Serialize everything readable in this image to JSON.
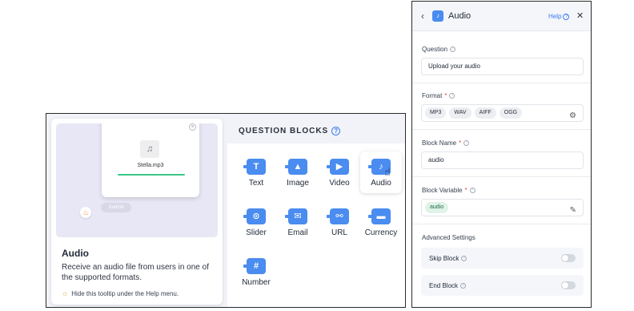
{
  "tooltip": {
    "file_name": "Stella.mp3",
    "submit_label": "Submit",
    "title": "Audio",
    "description": "Receive an audio file from users in one of the supported formats.",
    "hint": "Hide this tooltip under the Help menu."
  },
  "question_blocks": {
    "header": "QUESTION BLOCKS",
    "items": [
      {
        "label": "Text",
        "icon": "text-icon",
        "glyph": "T"
      },
      {
        "label": "Image",
        "icon": "image-icon",
        "glyph": "▲"
      },
      {
        "label": "Video",
        "icon": "video-icon",
        "glyph": "▶"
      },
      {
        "label": "Audio",
        "icon": "audio-icon",
        "glyph": "♪"
      },
      {
        "label": "Slider",
        "icon": "slider-icon",
        "glyph": "⊙"
      },
      {
        "label": "Email",
        "icon": "email-icon",
        "glyph": "✉"
      },
      {
        "label": "URL",
        "icon": "link-icon",
        "glyph": "⚯"
      },
      {
        "label": "Currency",
        "icon": "currency-icon",
        "glyph": "▬"
      },
      {
        "label": "Number",
        "icon": "number-icon",
        "glyph": "#"
      }
    ]
  },
  "settings": {
    "title": "Audio",
    "help_label": "Help",
    "question_label": "Question",
    "question_value": "Upload your audio",
    "format_label": "Format",
    "formats": [
      "MP3",
      "WAV",
      "AIFF",
      "OGG"
    ],
    "block_name_label": "Block Name",
    "block_name_value": "audio",
    "block_variable_label": "Block Variable",
    "block_variable_value": "audio",
    "advanced_label": "Advanced Settings",
    "skip_block_label": "Skip Block",
    "end_block_label": "End Block"
  },
  "colors": {
    "accent": "#4a8cf0",
    "required": "#e24a4a",
    "progress": "#3cc68a"
  }
}
